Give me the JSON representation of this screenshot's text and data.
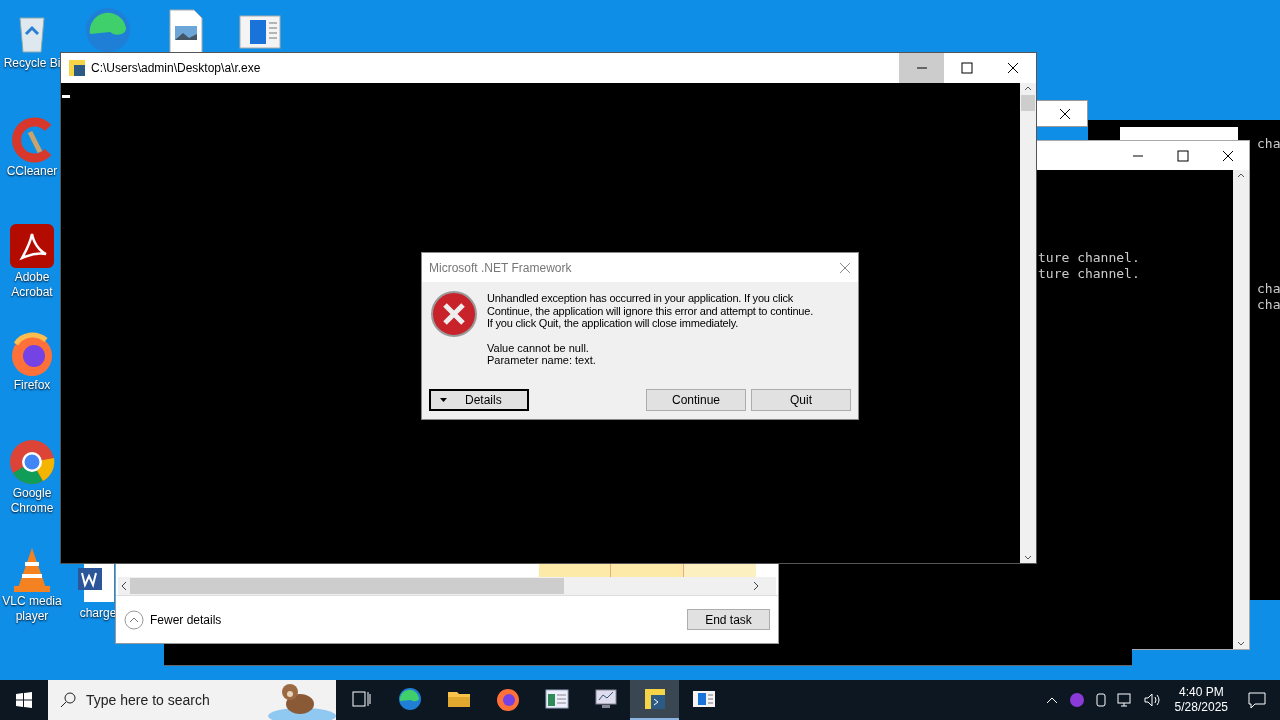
{
  "desktop_icons": [
    {
      "kind": "recycle",
      "lines": [
        "Recycle Bi"
      ]
    },
    {
      "kind": "edge"
    },
    {
      "kind": "image-file"
    },
    {
      "kind": "window-file"
    },
    {
      "kind": "ccleaner",
      "lines": [
        "CCleaner"
      ]
    },
    {
      "kind": "acrobat",
      "lines": [
        "Adobe",
        "Acrobat"
      ]
    },
    {
      "kind": "firefox",
      "lines": [
        "Firefox"
      ]
    },
    {
      "kind": "chrome",
      "lines": [
        "Google",
        "Chrome"
      ]
    },
    {
      "kind": "vlc",
      "lines": [
        "VLC media",
        "player"
      ]
    },
    {
      "kind": "word",
      "lines": [
        "charge"
      ]
    }
  ],
  "right_console": {
    "lines": [
      "ture channel.",
      "ture channel."
    ]
  },
  "far_console": {
    "lines": [
      "cha",
      "cha",
      "cha"
    ]
  },
  "task_manager": {
    "fewer_details": "Fewer details",
    "end_task": "End task"
  },
  "console": {
    "title": "C:\\Users\\admin\\Desktop\\a\\r.exe"
  },
  "dialog": {
    "title": "Microsoft .NET Framework",
    "message": [
      "Unhandled exception has occurred in your application. If you click",
      "Continue, the application will ignore this error and attempt to continue.",
      "If you click Quit, the application will close immediately."
    ],
    "details": [
      "Value cannot be null.",
      "Parameter name: text."
    ],
    "details_button": "Details",
    "continue_button": "Continue",
    "quit_button": "Quit"
  },
  "taskbar": {
    "search_placeholder": "Type here to search",
    "apps": [
      {
        "kind": "task-view",
        "selected": false
      },
      {
        "kind": "edge",
        "selected": false
      },
      {
        "kind": "folder",
        "selected": false
      },
      {
        "kind": "firefox",
        "selected": false
      },
      {
        "kind": "window-app",
        "selected": false
      },
      {
        "kind": "monitor-app",
        "selected": false
      },
      {
        "kind": "python-app",
        "selected": true
      },
      {
        "kind": "window-file",
        "selected": false
      }
    ],
    "time": "4:40 PM",
    "date": "5/28/2025"
  }
}
